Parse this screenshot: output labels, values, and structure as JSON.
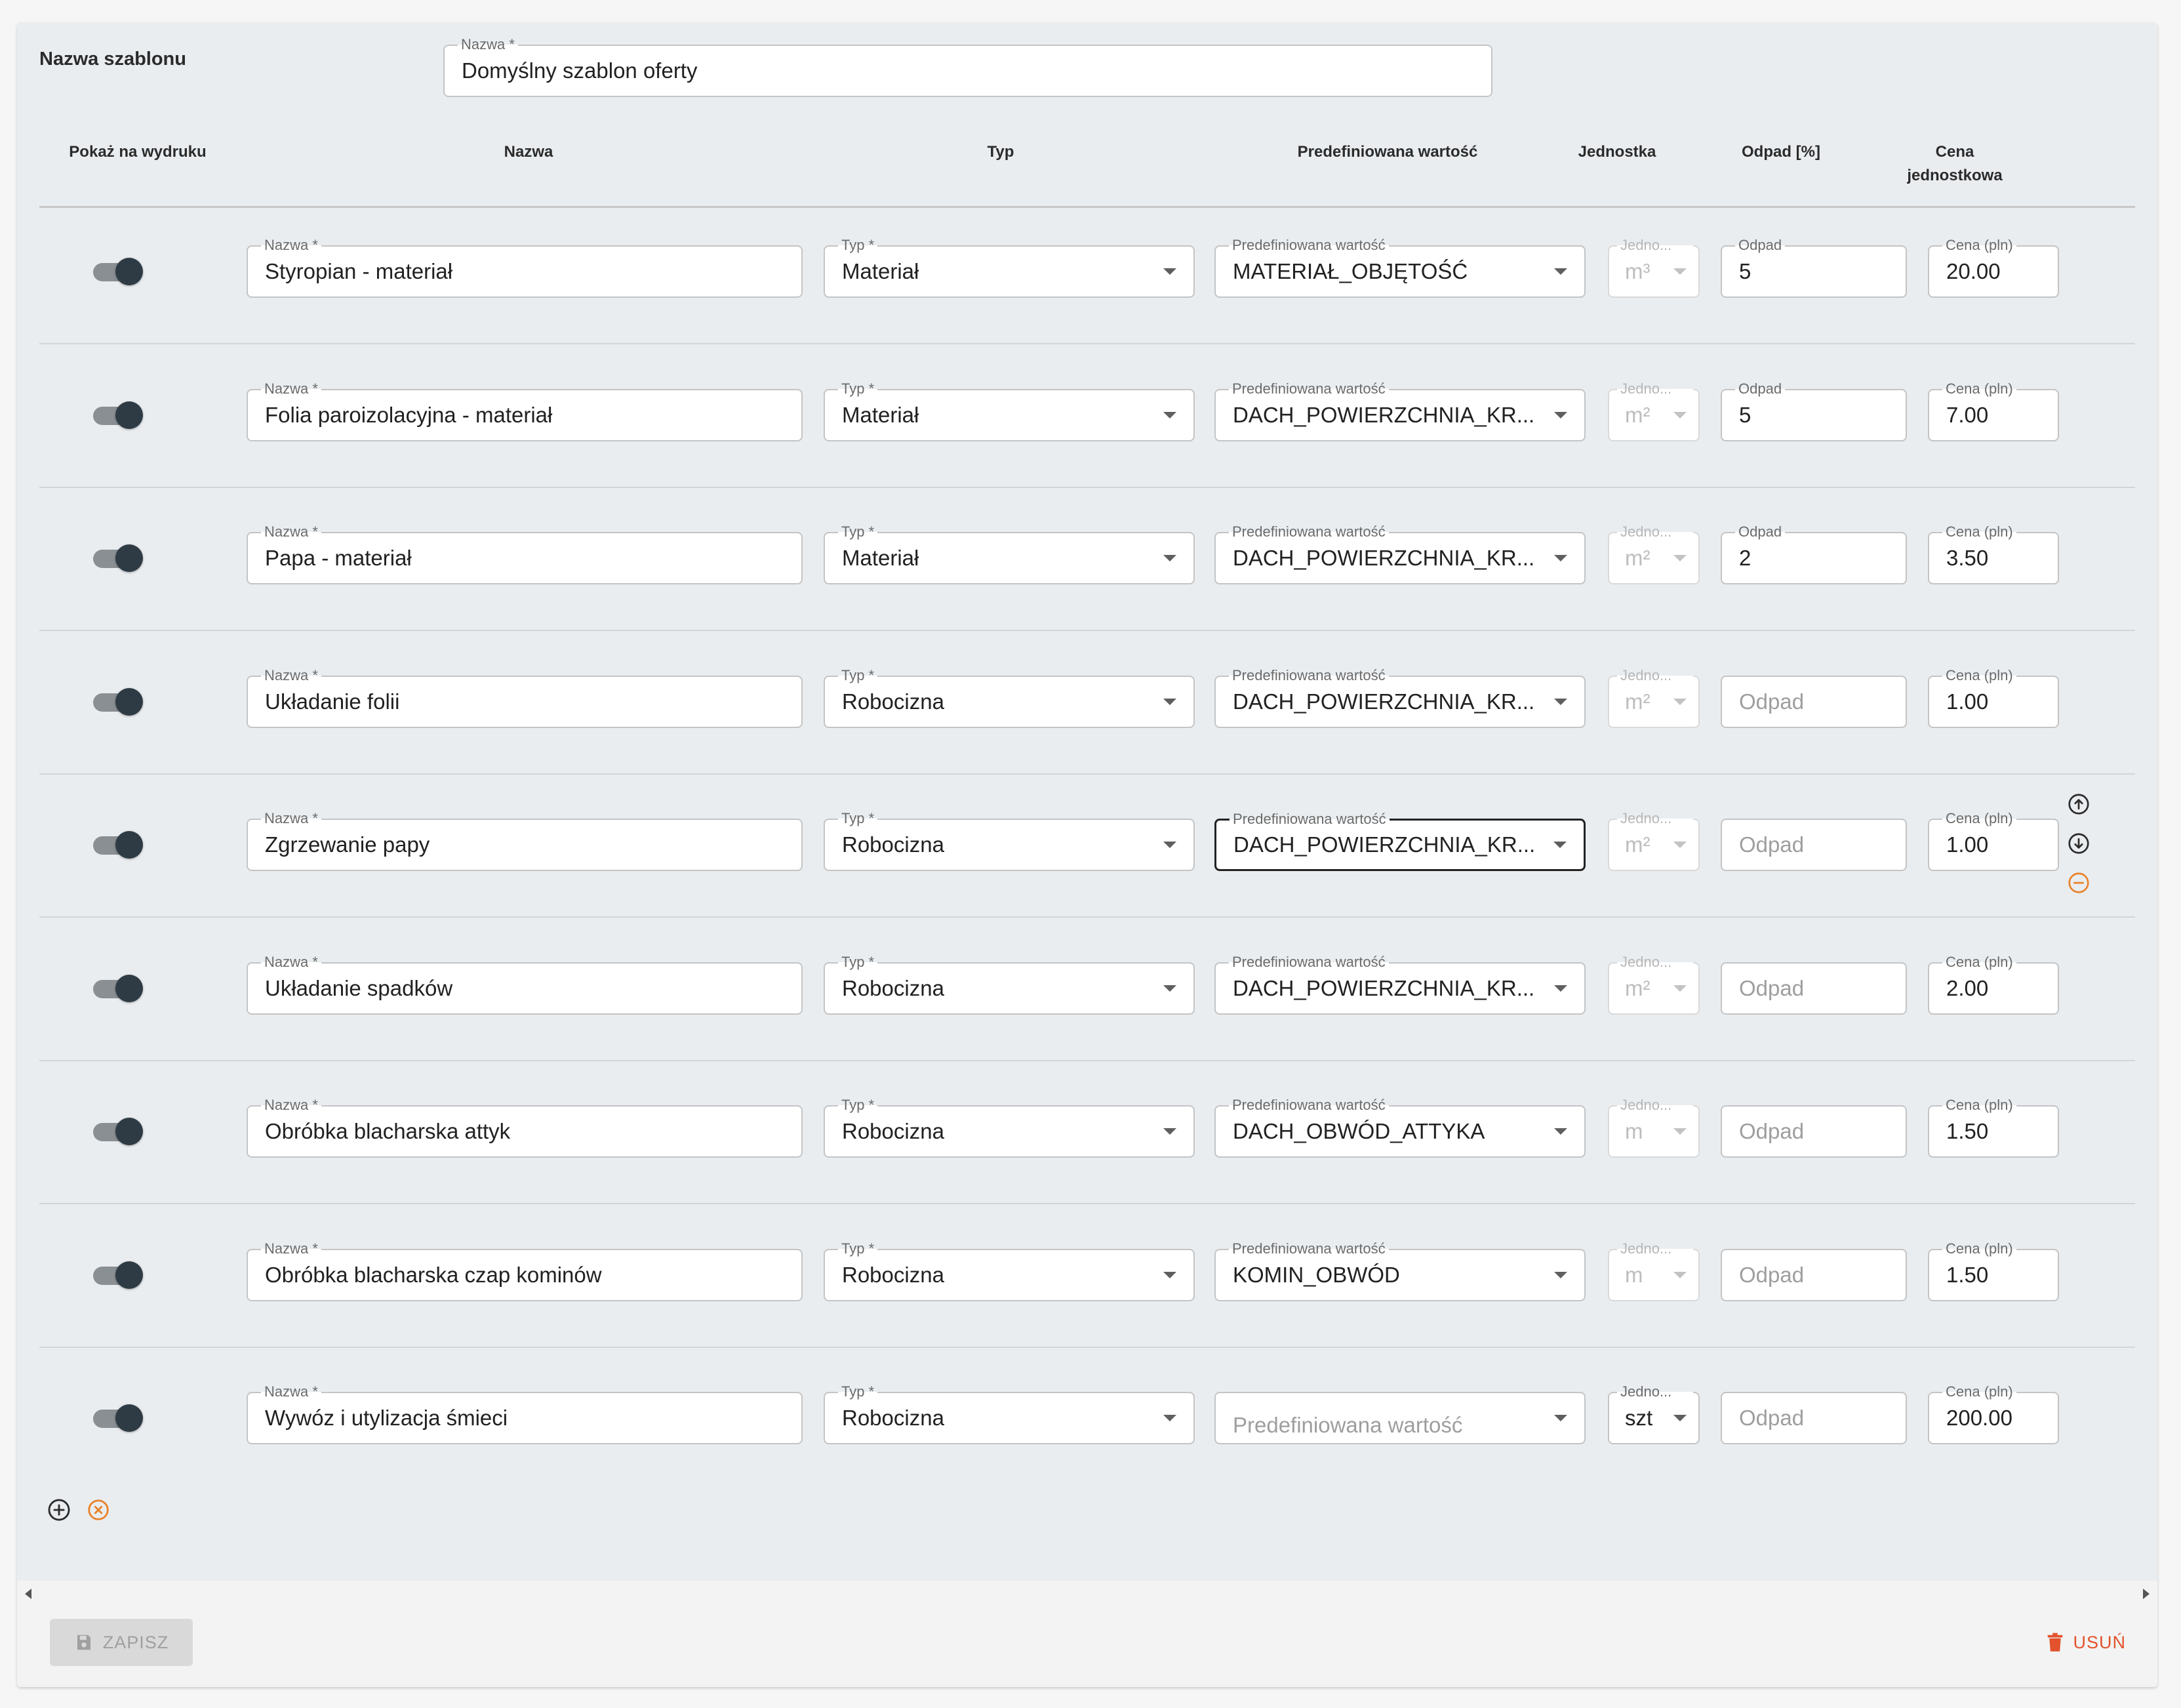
{
  "template": {
    "section_label": "Nazwa szablonu",
    "name_label": "Nazwa *",
    "name_value": "Domyślny szablon oferty"
  },
  "headers": {
    "show": "Pokaż na wydruku",
    "name": "Nazwa",
    "type": "Typ",
    "predefined": "Predefiniowana wartość",
    "unit": "Jednostka",
    "waste": "Odpad [%]",
    "price_line1": "Cena",
    "price_line2": "jednostkowa"
  },
  "labels": {
    "name": "Nazwa *",
    "type": "Typ *",
    "predefined": "Predefiniowana wartość",
    "unit": "Jedno...",
    "waste": "Odpad",
    "price": "Cena (pln)"
  },
  "placeholders": {
    "predefined": "Predefiniowana wartość",
    "waste": "Odpad"
  },
  "rows": [
    {
      "show": true,
      "name": "Styropian - materiał",
      "type": "Materiał",
      "predefined": "MATERIAŁ_OBJĘTOŚĆ",
      "unit": "m³",
      "waste": "5",
      "price": "20.00"
    },
    {
      "show": true,
      "name": "Folia paroizolacyjna - materiał",
      "type": "Materiał",
      "predefined": "DACH_POWIERZCHNIA_KR...",
      "unit": "m²",
      "waste": "5",
      "price": "7.00"
    },
    {
      "show": true,
      "name": "Papa - materiał",
      "type": "Materiał",
      "predefined": "DACH_POWIERZCHNIA_KR...",
      "unit": "m²",
      "waste": "2",
      "price": "3.50"
    },
    {
      "show": true,
      "name": "Układanie folii",
      "type": "Robocizna",
      "predefined": "DACH_POWIERZCHNIA_KR...",
      "unit": "m²",
      "waste": "",
      "price": "1.00"
    },
    {
      "show": true,
      "name": "Zgrzewanie papy",
      "type": "Robocizna",
      "predefined": "DACH_POWIERZCHNIA_KR...",
      "unit": "m²",
      "waste": "",
      "price": "1.00"
    },
    {
      "show": true,
      "name": "Układanie spadków",
      "type": "Robocizna",
      "predefined": "DACH_POWIERZCHNIA_KR...",
      "unit": "m²",
      "waste": "",
      "price": "2.00"
    },
    {
      "show": true,
      "name": "Obróbka blacharska attyk",
      "type": "Robocizna",
      "predefined": "DACH_OBWÓD_ATTYKA",
      "unit": "m",
      "waste": "",
      "price": "1.50"
    },
    {
      "show": true,
      "name": "Obróbka blacharska czap kominów",
      "type": "Robocizna",
      "predefined": "KOMIN_OBWÓD",
      "unit": "m",
      "waste": "",
      "price": "1.50"
    },
    {
      "show": true,
      "name": "Wywóz i utylizacja śmieci",
      "type": "Robocizna",
      "predefined": "",
      "unit": "szt",
      "waste": "",
      "price": "200.00"
    }
  ],
  "actions": {
    "save_label": "ZAPISZ",
    "delete_label": "USUŃ"
  },
  "colors": {
    "toggle_thumb": "#2e3b44",
    "accent_orange": "#e8832a",
    "delete_red": "#e2522c",
    "panel_bg": "#eaedf0"
  }
}
